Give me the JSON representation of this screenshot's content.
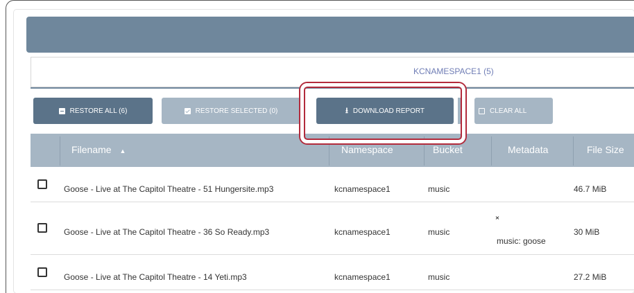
{
  "namespace_tab": {
    "label": "KCNAMESPACE1 (5)"
  },
  "toolbar": {
    "restore_all": "RESTORE ALL (6)",
    "restore_selected": "RESTORE SELECTED (0)",
    "download_report": "DOWNLOAD REPORT",
    "clear_all": "CLEAR ALL"
  },
  "table": {
    "columns": [
      "Filename",
      "Namespace",
      "Bucket",
      "Metadata",
      "File Size"
    ],
    "sort_indicator": "▲",
    "rows": [
      {
        "filename": "Goose - Live at The Capitol Theatre - 51 Hungersite.mp3",
        "namespace": "kcnamespace1",
        "bucket": "music",
        "metadata": "",
        "size": "46.7 MiB"
      },
      {
        "filename": "Goose - Live at The Capitol Theatre - 36 So Ready.mp3",
        "namespace": "kcnamespace1",
        "bucket": "music",
        "metadata": "music: goose",
        "size": "30 MiB"
      },
      {
        "filename": "Goose - Live at The Capitol Theatre - 14 Yeti.mp3",
        "namespace": "kcnamespace1",
        "bucket": "music",
        "metadata": "",
        "size": "27.2 MiB"
      }
    ]
  },
  "colors": {
    "header": "#6f879c",
    "primary_button": "#5b7389",
    "disabled_button": "#a6b6c4",
    "table_header": "#a6b6c4",
    "highlight_outline": "#b22a3b",
    "tab_text": "#6f7db5"
  },
  "icons": {
    "restore_all": "archive-icon",
    "restore_selected": "checkbox-checked-icon",
    "download_report": "download-icon",
    "clear_all": "checkbox-empty-icon",
    "metadata_toggle": "chevron-expand-icon"
  }
}
